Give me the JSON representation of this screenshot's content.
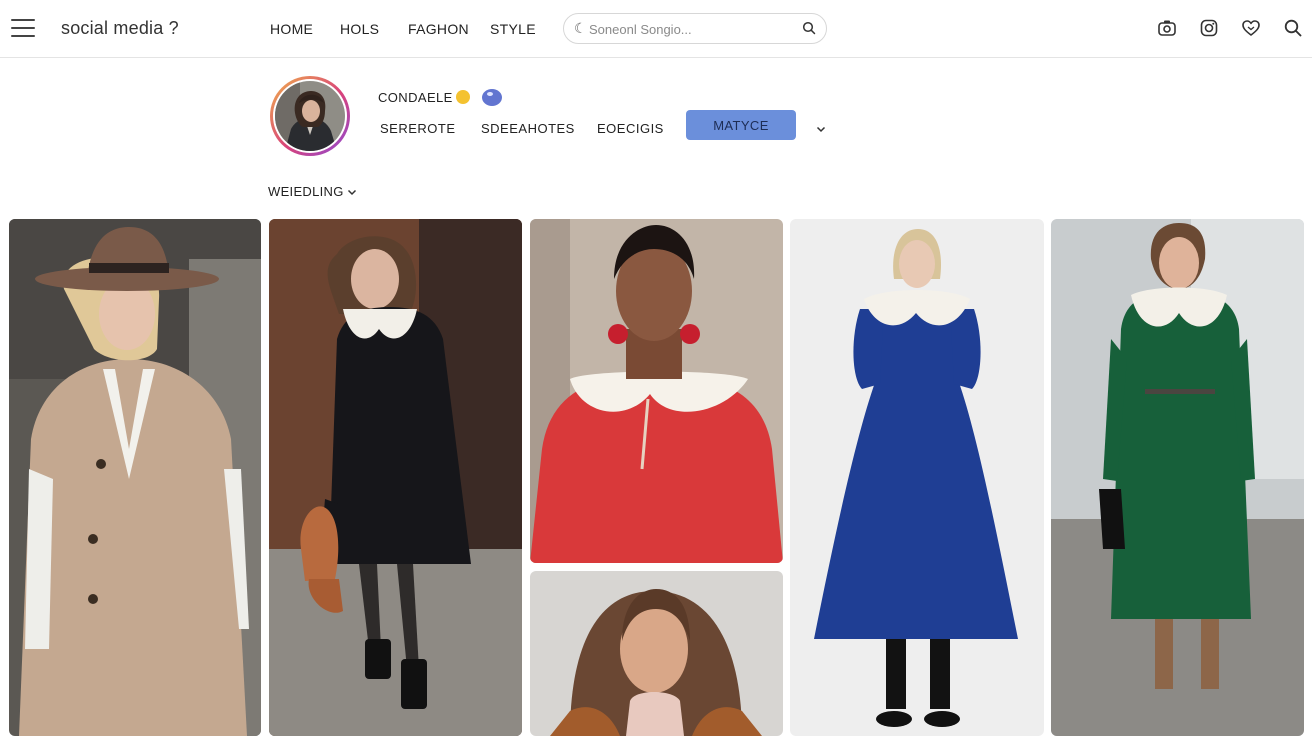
{
  "header": {
    "brand": "social media ?",
    "nav": [
      "HOME",
      "HOLS",
      "FAGHON",
      "STYLE"
    ],
    "search_placeholder": "Soneonl Songio..."
  },
  "profile": {
    "name": "CONDAELE",
    "tabs": [
      "SEREROTE",
      "SDEEAHOTES",
      "EOECIGIS"
    ],
    "primary_button": "MATYCE"
  },
  "filter": {
    "label": "WEIEDLING"
  },
  "icons": [
    "menu-icon",
    "search-icon",
    "camera-icon",
    "instagram-icon",
    "heart-icon",
    "search-icon",
    "chevron-down-icon"
  ],
  "colors": {
    "accent_button": "#6b8fdb",
    "verified_yellow": "#f4c230",
    "badge_blue": "#6275d0"
  }
}
